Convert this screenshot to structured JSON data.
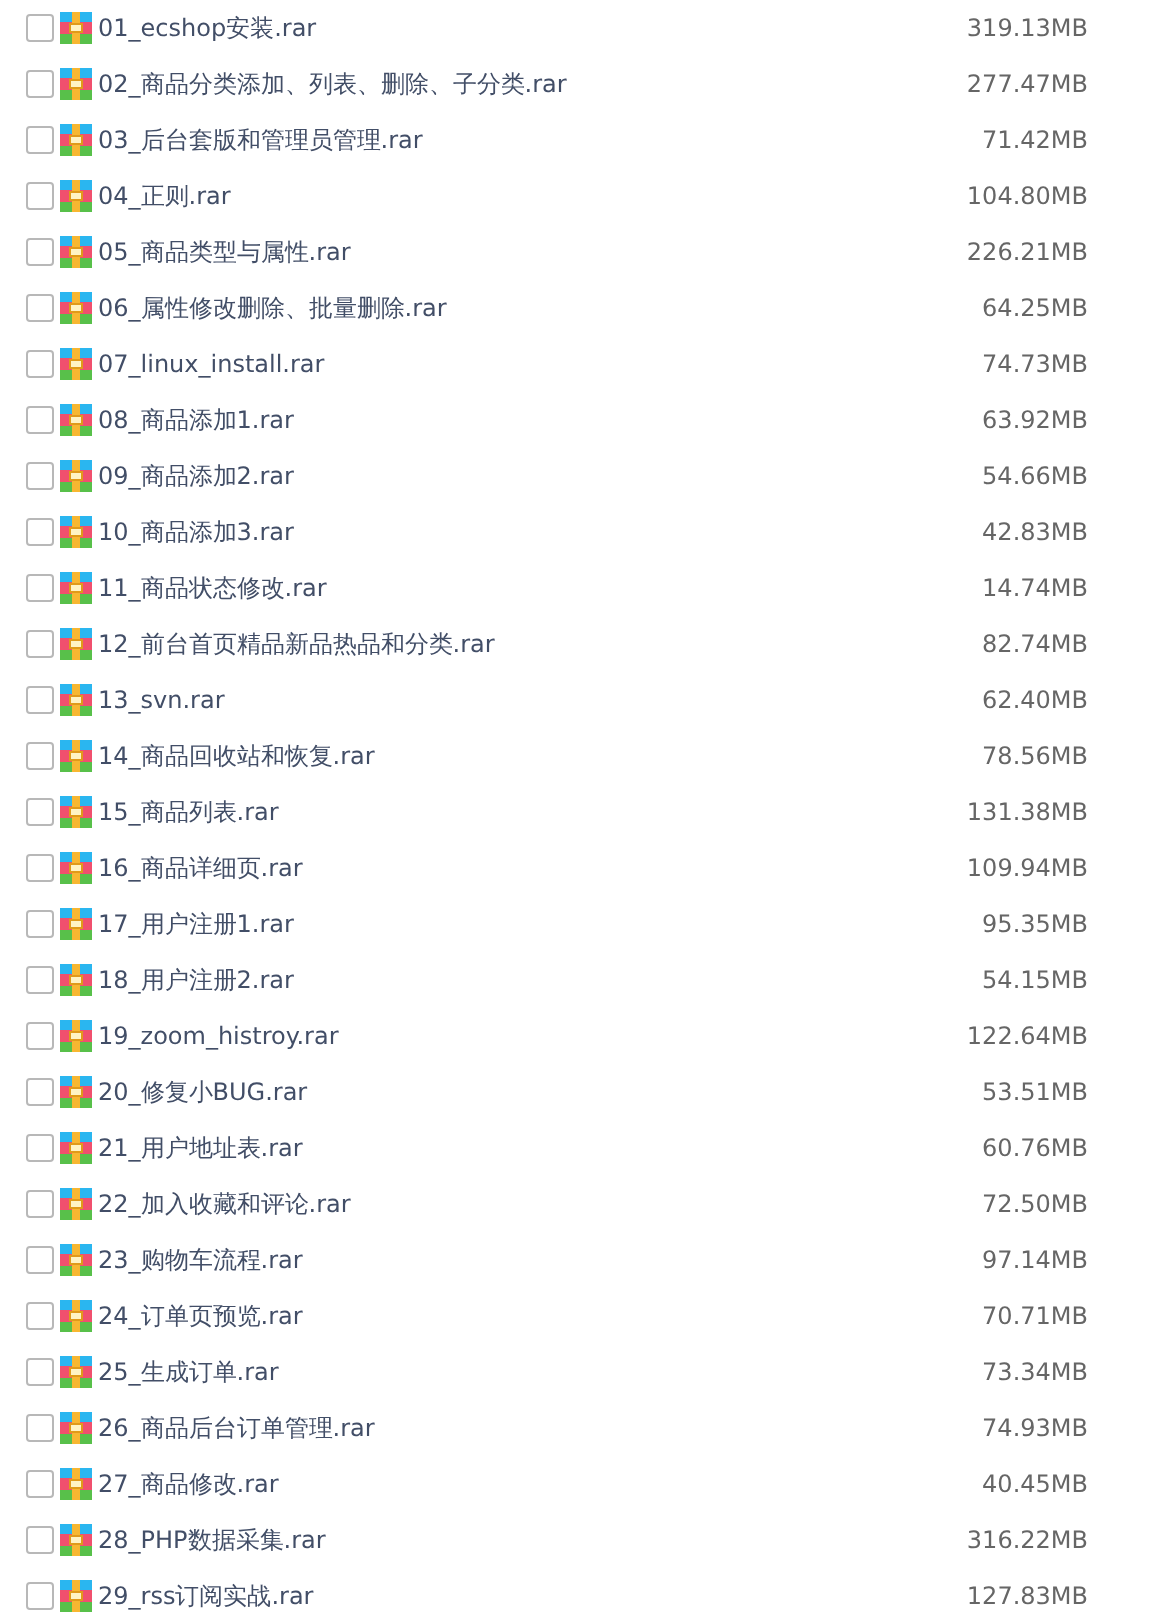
{
  "files": [
    {
      "name": "01_ecshop安装.rar",
      "size": "319.13MB",
      "checked": false
    },
    {
      "name": "02_商品分类添加、列表、删除、子分类.rar",
      "size": "277.47MB",
      "checked": false
    },
    {
      "name": "03_后台套版和管理员管理.rar",
      "size": "71.42MB",
      "checked": false
    },
    {
      "name": "04_正则.rar",
      "size": "104.80MB",
      "checked": false
    },
    {
      "name": "05_商品类型与属性.rar",
      "size": "226.21MB",
      "checked": false
    },
    {
      "name": "06_属性修改删除、批量删除.rar",
      "size": "64.25MB",
      "checked": false
    },
    {
      "name": "07_linux_install.rar",
      "size": "74.73MB",
      "checked": false
    },
    {
      "name": "08_商品添加1.rar",
      "size": "63.92MB",
      "checked": false
    },
    {
      "name": "09_商品添加2.rar",
      "size": "54.66MB",
      "checked": false
    },
    {
      "name": "10_商品添加3.rar",
      "size": "42.83MB",
      "checked": false
    },
    {
      "name": "11_商品状态修改.rar",
      "size": "14.74MB",
      "checked": false
    },
    {
      "name": "12_前台首页精品新品热品和分类.rar",
      "size": "82.74MB",
      "checked": false
    },
    {
      "name": "13_svn.rar",
      "size": "62.40MB",
      "checked": false
    },
    {
      "name": "14_商品回收站和恢复.rar",
      "size": "78.56MB",
      "checked": false
    },
    {
      "name": "15_商品列表.rar",
      "size": "131.38MB",
      "checked": false
    },
    {
      "name": "16_商品详细页.rar",
      "size": "109.94MB",
      "checked": false
    },
    {
      "name": "17_用户注册1.rar",
      "size": "95.35MB",
      "checked": false
    },
    {
      "name": "18_用户注册2.rar",
      "size": "54.15MB",
      "checked": false
    },
    {
      "name": "19_zoom_histroy.rar",
      "size": "122.64MB",
      "checked": false
    },
    {
      "name": "20_修复小BUG.rar",
      "size": "53.51MB",
      "checked": false
    },
    {
      "name": "21_用户地址表.rar",
      "size": "60.76MB",
      "checked": false
    },
    {
      "name": "22_加入收藏和评论.rar",
      "size": "72.50MB",
      "checked": false
    },
    {
      "name": "23_购物车流程.rar",
      "size": "97.14MB",
      "checked": false
    },
    {
      "name": "24_订单页预览.rar",
      "size": "70.71MB",
      "checked": false
    },
    {
      "name": "25_生成订单.rar",
      "size": "73.34MB",
      "checked": false
    },
    {
      "name": "26_商品后台订单管理.rar",
      "size": "74.93MB",
      "checked": false
    },
    {
      "name": "27_商品修改.rar",
      "size": "40.45MB",
      "checked": false
    },
    {
      "name": "28_PHP数据采集.rar",
      "size": "316.22MB",
      "checked": false
    },
    {
      "name": "29_rss订阅实战.rar",
      "size": "127.83MB",
      "checked": false
    }
  ]
}
